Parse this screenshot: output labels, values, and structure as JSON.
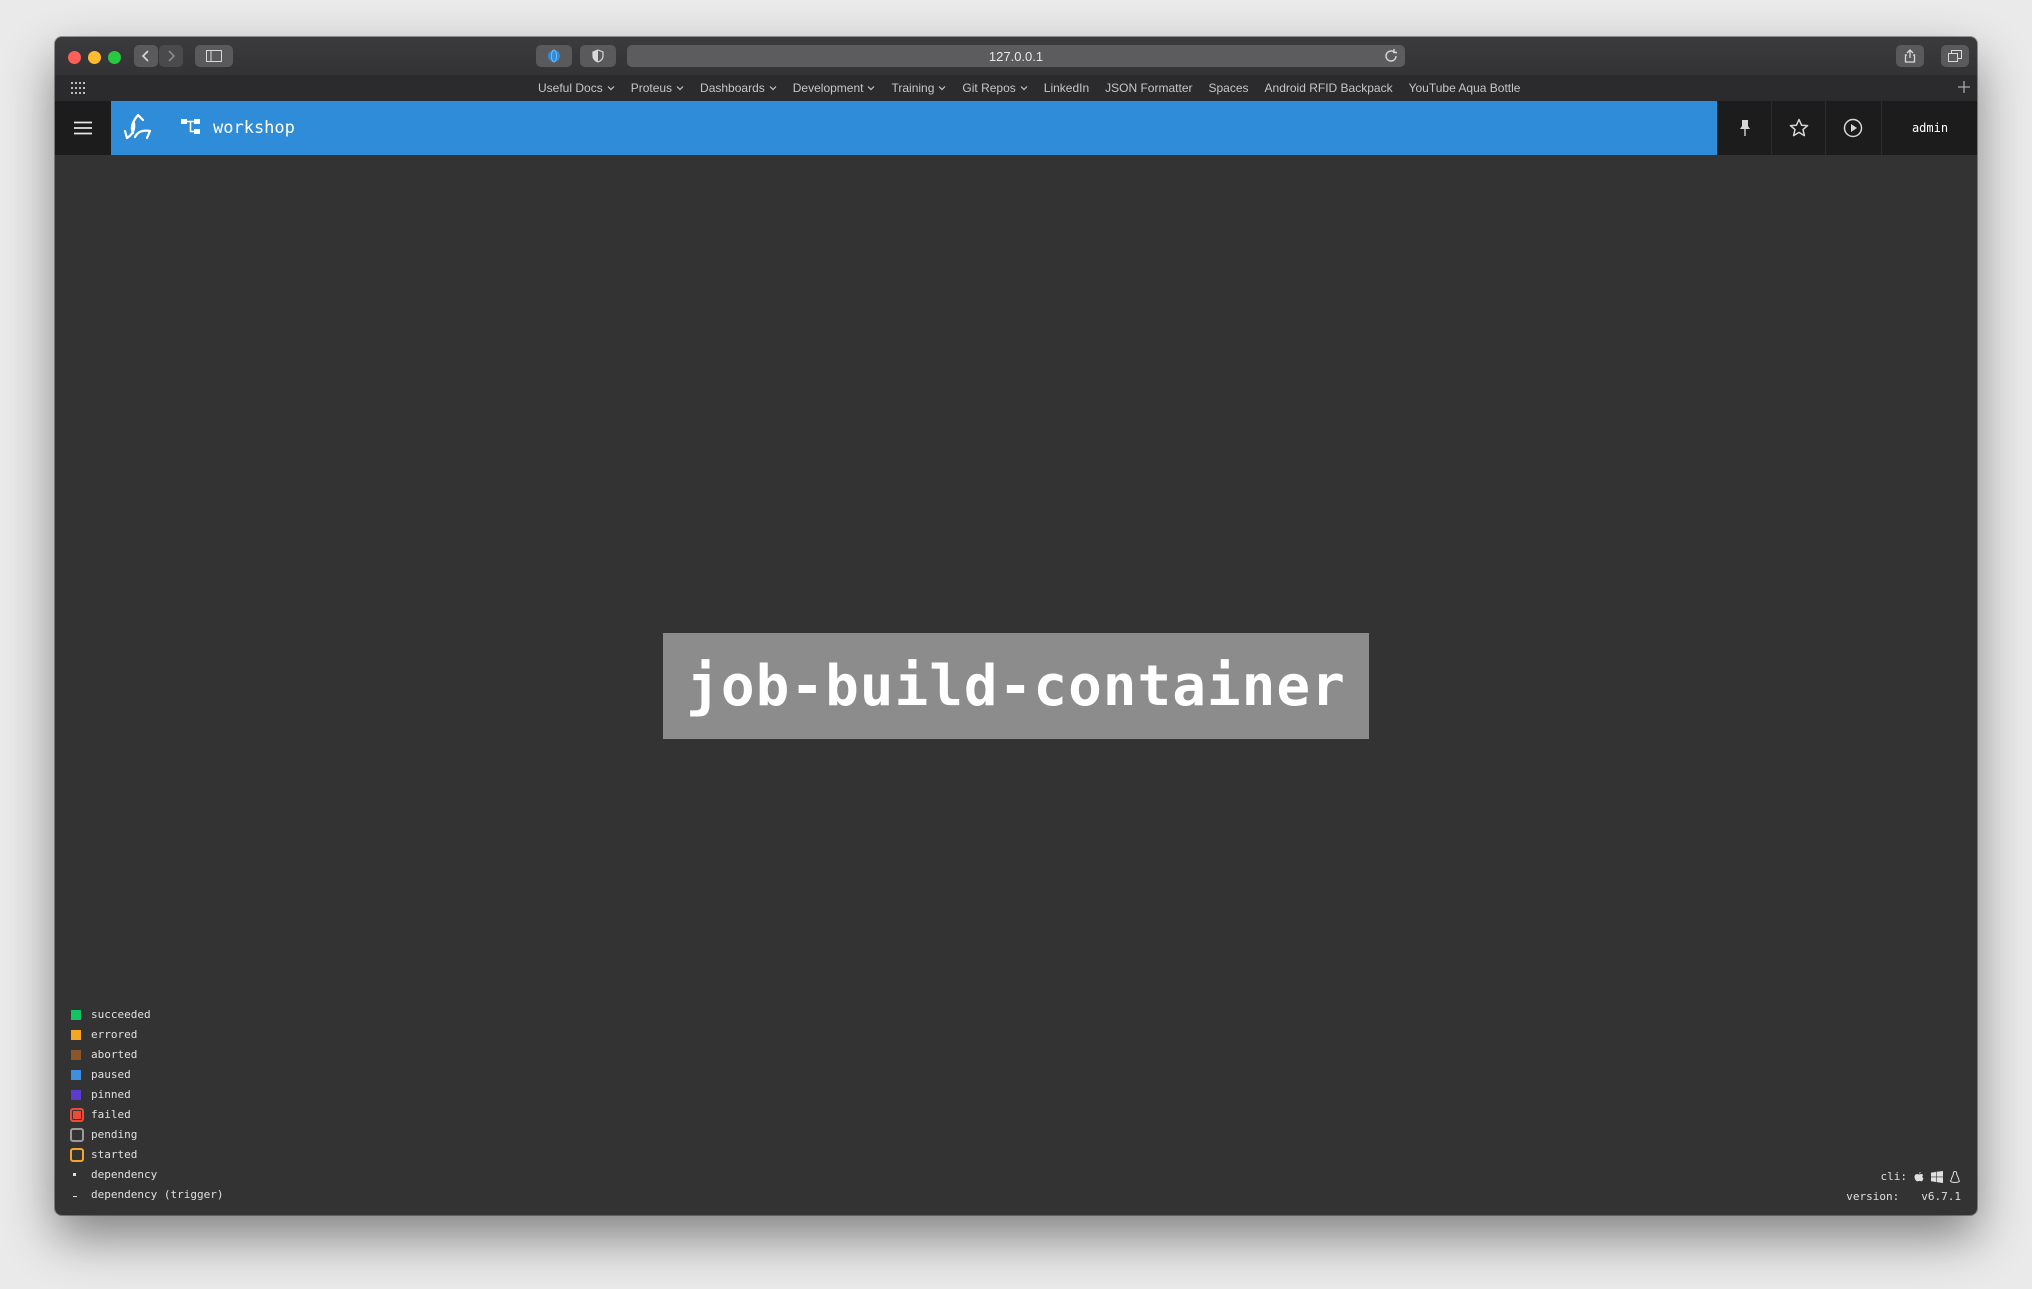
{
  "browser": {
    "url": "127.0.0.1",
    "bookmarks": [
      {
        "label": "Useful Docs",
        "dropdown": true
      },
      {
        "label": "Proteus",
        "dropdown": true
      },
      {
        "label": "Dashboards",
        "dropdown": true
      },
      {
        "label": "Development",
        "dropdown": true
      },
      {
        "label": "Training",
        "dropdown": true
      },
      {
        "label": "Git Repos",
        "dropdown": true
      },
      {
        "label": "LinkedIn",
        "dropdown": false
      },
      {
        "label": "JSON Formatter",
        "dropdown": false
      },
      {
        "label": "Spaces",
        "dropdown": false
      },
      {
        "label": "Android RFID Backpack",
        "dropdown": false
      },
      {
        "label": "YouTube Aqua Bottle",
        "dropdown": false
      }
    ]
  },
  "header": {
    "pipeline_name": "workshop",
    "user": "admin",
    "bar_color": "#2f8cd8"
  },
  "main": {
    "job_name": "job-build-container"
  },
  "legend": [
    {
      "label": "succeeded",
      "color": "#11c560",
      "style": "fill"
    },
    {
      "label": "errored",
      "color": "#f5a623",
      "style": "fill"
    },
    {
      "label": "aborted",
      "color": "#8b572a",
      "style": "fill"
    },
    {
      "label": "paused",
      "color": "#3d8fe0",
      "style": "fill"
    },
    {
      "label": "pinned",
      "color": "#5c3bd1",
      "style": "fill"
    },
    {
      "label": "failed",
      "color": "#ed4b35",
      "style": "outline-fill"
    },
    {
      "label": "pending",
      "color": "#9b9b9b",
      "style": "outline"
    },
    {
      "label": "started",
      "color": "#f5a623",
      "style": "outline"
    },
    {
      "label": "dependency",
      "color": "#e0e0e0",
      "style": "dot"
    },
    {
      "label": "dependency (trigger)",
      "color": "#e0e0e0",
      "style": "dash"
    }
  ],
  "footer": {
    "cli_label": "cli:",
    "version_label": "version:",
    "version": "v6.7.1",
    "cli_icons": [
      "apple-icon",
      "windows-icon",
      "linux-icon"
    ]
  }
}
